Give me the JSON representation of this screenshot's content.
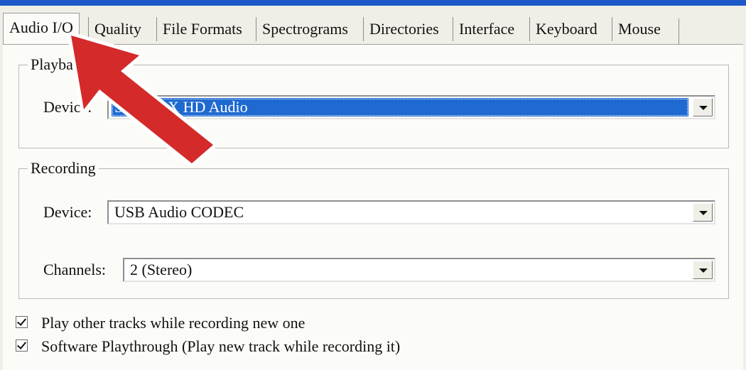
{
  "tabs": [
    {
      "label": "Audio I/O",
      "active": true
    },
    {
      "label": "Quality",
      "active": false
    },
    {
      "label": "File Formats",
      "active": false
    },
    {
      "label": "Spectrograms",
      "active": false
    },
    {
      "label": "Directories",
      "active": false
    },
    {
      "label": "Interface",
      "active": false
    },
    {
      "label": "Keyboard",
      "active": false
    },
    {
      "label": "Mouse",
      "active": false
    }
  ],
  "playback": {
    "legend": "Playba",
    "device_label": "Device:",
    "device_value": "Sou   MAX HD Audio"
  },
  "recording": {
    "legend": "Recording",
    "device_label": "Device:",
    "device_value": "USB Audio CODEC",
    "channels_label": "Channels:",
    "channels_value": "2 (Stereo)"
  },
  "options": [
    {
      "label": "Play other tracks while recording new one",
      "checked": true
    },
    {
      "label": "Software Playthrough (Play new track while recording it)",
      "checked": true
    }
  ],
  "colors": {
    "selection": "#1f6ad1",
    "annotation_arrow": "#d42a2a"
  }
}
